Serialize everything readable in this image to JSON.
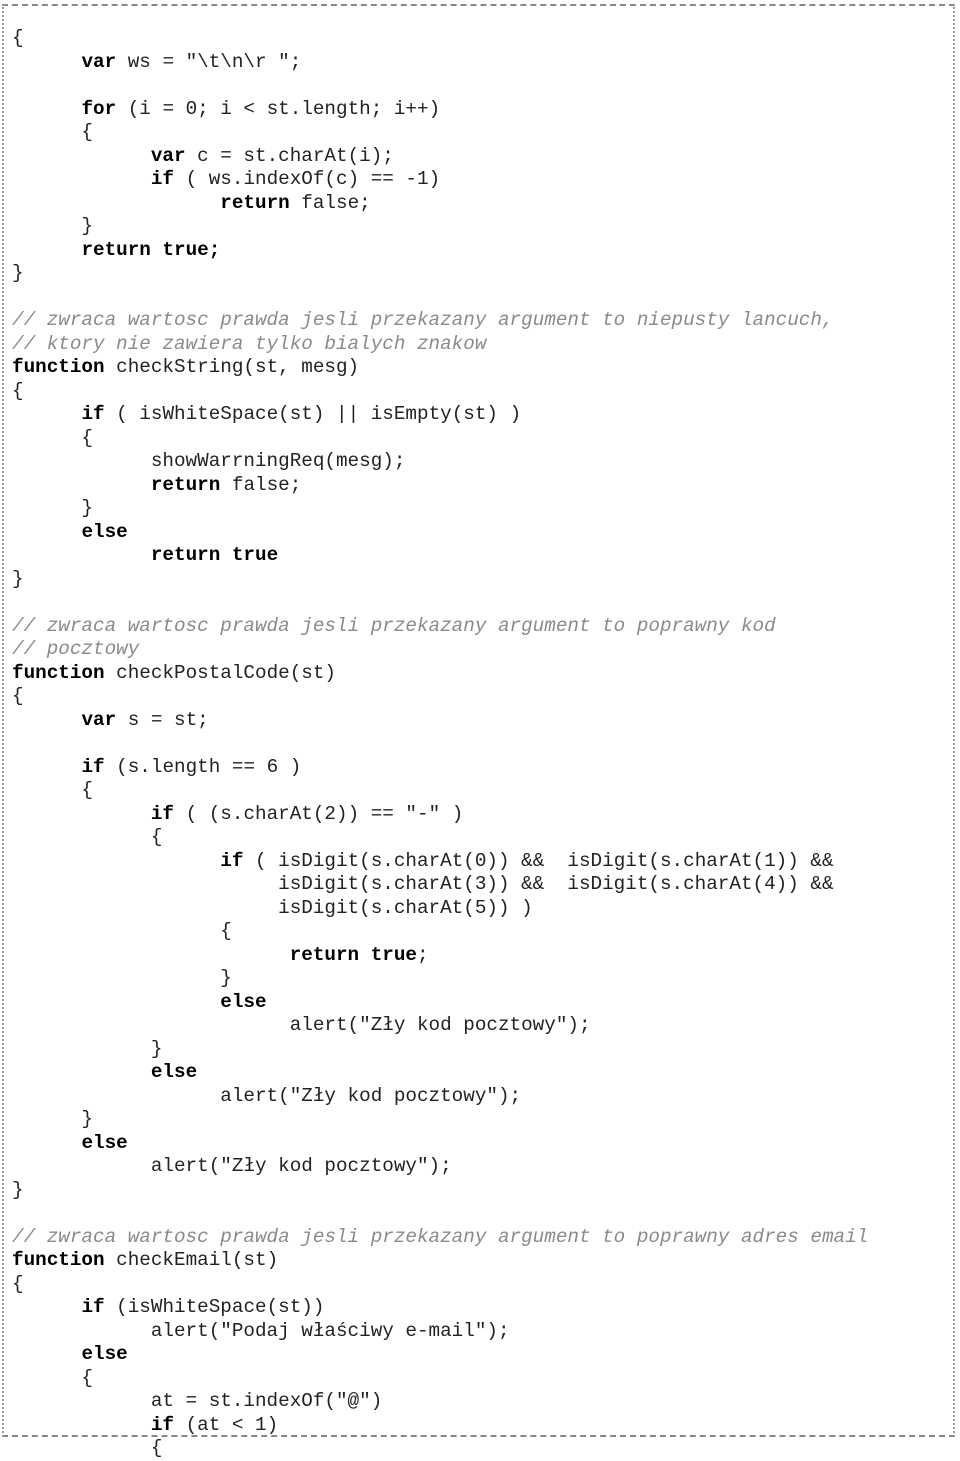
{
  "lines": [
    [
      {
        "t": "tx",
        "v": "{"
      }
    ],
    [
      {
        "t": "tx",
        "v": "      "
      },
      {
        "t": "kw",
        "v": "var"
      },
      {
        "t": "tx",
        "v": " ws = \"\\t\\n\\r \";"
      }
    ],
    [],
    [
      {
        "t": "tx",
        "v": "      "
      },
      {
        "t": "kw",
        "v": "for"
      },
      {
        "t": "tx",
        "v": " (i = 0; i < st.length; i++)"
      }
    ],
    [
      {
        "t": "tx",
        "v": "      {"
      }
    ],
    [
      {
        "t": "tx",
        "v": "            "
      },
      {
        "t": "kw",
        "v": "var"
      },
      {
        "t": "tx",
        "v": " c = st.charAt(i);"
      }
    ],
    [
      {
        "t": "tx",
        "v": "            "
      },
      {
        "t": "kw",
        "v": "if"
      },
      {
        "t": "tx",
        "v": " ( ws.indexOf(c) == -1)"
      }
    ],
    [
      {
        "t": "tx",
        "v": "                  "
      },
      {
        "t": "kw",
        "v": "return"
      },
      {
        "t": "tx",
        "v": " false;"
      }
    ],
    [
      {
        "t": "tx",
        "v": "      }"
      }
    ],
    [
      {
        "t": "tx",
        "v": "      "
      },
      {
        "t": "kw",
        "v": "return true;"
      }
    ],
    [
      {
        "t": "tx",
        "v": "}"
      }
    ],
    [],
    [
      {
        "t": "cm",
        "v": "// zwraca wartosc prawda jesli przekazany argument to niepusty lancuch,"
      }
    ],
    [
      {
        "t": "cm",
        "v": "// ktory nie zawiera tylko bialych znakow"
      }
    ],
    [
      {
        "t": "kw",
        "v": "function"
      },
      {
        "t": "tx",
        "v": " checkString(st, mesg)"
      }
    ],
    [
      {
        "t": "tx",
        "v": "{"
      }
    ],
    [
      {
        "t": "tx",
        "v": "      "
      },
      {
        "t": "kw",
        "v": "if"
      },
      {
        "t": "tx",
        "v": " ( isWhiteSpace(st) || isEmpty(st) )"
      }
    ],
    [
      {
        "t": "tx",
        "v": "      {"
      }
    ],
    [
      {
        "t": "tx",
        "v": "            showWarrningReq(mesg);"
      }
    ],
    [
      {
        "t": "tx",
        "v": "            "
      },
      {
        "t": "kw",
        "v": "return"
      },
      {
        "t": "tx",
        "v": " false;"
      }
    ],
    [
      {
        "t": "tx",
        "v": "      }"
      }
    ],
    [
      {
        "t": "tx",
        "v": "      "
      },
      {
        "t": "kw",
        "v": "else"
      }
    ],
    [
      {
        "t": "tx",
        "v": "            "
      },
      {
        "t": "kw",
        "v": "return true"
      }
    ],
    [
      {
        "t": "tx",
        "v": "}"
      }
    ],
    [],
    [
      {
        "t": "cm",
        "v": "// zwraca wartosc prawda jesli przekazany argument to poprawny kod"
      }
    ],
    [
      {
        "t": "cm",
        "v": "// pocztowy"
      }
    ],
    [
      {
        "t": "kw",
        "v": "function"
      },
      {
        "t": "tx",
        "v": " checkPostalCode(st)"
      }
    ],
    [
      {
        "t": "tx",
        "v": "{"
      }
    ],
    [
      {
        "t": "tx",
        "v": "      "
      },
      {
        "t": "kw",
        "v": "var"
      },
      {
        "t": "tx",
        "v": " s = st;"
      }
    ],
    [],
    [
      {
        "t": "tx",
        "v": "      "
      },
      {
        "t": "kw",
        "v": "if"
      },
      {
        "t": "tx",
        "v": " (s.length == 6 )"
      }
    ],
    [
      {
        "t": "tx",
        "v": "      {"
      }
    ],
    [
      {
        "t": "tx",
        "v": "            "
      },
      {
        "t": "kw",
        "v": "if"
      },
      {
        "t": "tx",
        "v": " ( (s.charAt(2)) == \"-\" )"
      }
    ],
    [
      {
        "t": "tx",
        "v": "            {"
      }
    ],
    [
      {
        "t": "tx",
        "v": "                  "
      },
      {
        "t": "kw",
        "v": "if"
      },
      {
        "t": "tx",
        "v": " ( isDigit(s.charAt(0)) &&  isDigit(s.charAt(1)) &&"
      }
    ],
    [
      {
        "t": "tx",
        "v": "                       isDigit(s.charAt(3)) &&  isDigit(s.charAt(4)) &&"
      }
    ],
    [
      {
        "t": "tx",
        "v": "                       isDigit(s.charAt(5)) )"
      }
    ],
    [
      {
        "t": "tx",
        "v": "                  {"
      }
    ],
    [
      {
        "t": "tx",
        "v": "                        "
      },
      {
        "t": "kw",
        "v": "return true"
      },
      {
        "t": "tx",
        "v": ";"
      }
    ],
    [
      {
        "t": "tx",
        "v": "                  }"
      }
    ],
    [
      {
        "t": "tx",
        "v": "                  "
      },
      {
        "t": "kw",
        "v": "else"
      }
    ],
    [
      {
        "t": "tx",
        "v": "                        alert(\"Zły kod pocztowy\");"
      }
    ],
    [
      {
        "t": "tx",
        "v": "            }"
      }
    ],
    [
      {
        "t": "tx",
        "v": "            "
      },
      {
        "t": "kw",
        "v": "else"
      }
    ],
    [
      {
        "t": "tx",
        "v": "                  alert(\"Zły kod pocztowy\");"
      }
    ],
    [
      {
        "t": "tx",
        "v": "      }"
      }
    ],
    [
      {
        "t": "tx",
        "v": "      "
      },
      {
        "t": "kw",
        "v": "else"
      }
    ],
    [
      {
        "t": "tx",
        "v": "            alert(\"Zły kod pocztowy\");"
      }
    ],
    [
      {
        "t": "tx",
        "v": "}"
      }
    ],
    [],
    [
      {
        "t": "cm",
        "v": "// zwraca wartosc prawda jesli przekazany argument to poprawny adres email"
      }
    ],
    [
      {
        "t": "kw",
        "v": "function"
      },
      {
        "t": "tx",
        "v": " checkEmail(st)"
      }
    ],
    [
      {
        "t": "tx",
        "v": "{"
      }
    ],
    [
      {
        "t": "tx",
        "v": "      "
      },
      {
        "t": "kw",
        "v": "if"
      },
      {
        "t": "tx",
        "v": " (isWhiteSpace(st))"
      }
    ],
    [
      {
        "t": "tx",
        "v": "            alert(\"Podaj właściwy e-mail\");"
      }
    ],
    [
      {
        "t": "tx",
        "v": "      "
      },
      {
        "t": "kw",
        "v": "else"
      }
    ],
    [
      {
        "t": "tx",
        "v": "      {"
      }
    ],
    [
      {
        "t": "tx",
        "v": "            at = st.indexOf(\"@\")"
      }
    ],
    [
      {
        "t": "tx",
        "v": "            "
      },
      {
        "t": "kw",
        "v": "if"
      },
      {
        "t": "tx",
        "v": " (at < 1)"
      }
    ],
    [
      {
        "t": "tx",
        "v": "            {"
      }
    ]
  ]
}
